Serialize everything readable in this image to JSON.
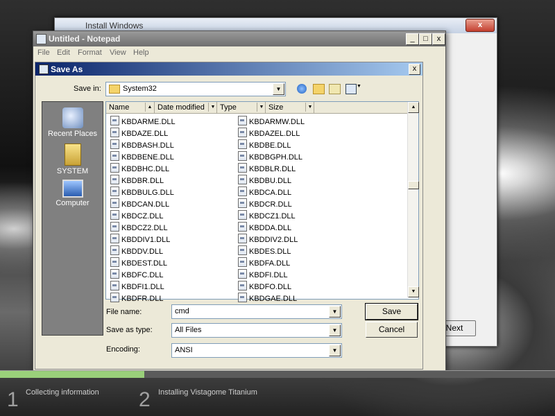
{
  "colors": {
    "titlebar_active": "#0a246a",
    "progress": "#9ad07a",
    "window_bg": "#ece9d8"
  },
  "install_window": {
    "title": "Install Windows",
    "close_label": "x",
    "next_button": "Next"
  },
  "notepad": {
    "title": "Untitled - Notepad",
    "min": "_",
    "max": "□",
    "close": "x",
    "menu": [
      "File",
      "Edit",
      "Format",
      "View",
      "Help"
    ]
  },
  "saveas": {
    "title": "Save As",
    "close": "x",
    "save_in_label": "Save in:",
    "save_in_value": "System32",
    "toolbar_icons": [
      "back-icon",
      "up-folder-icon",
      "new-folder-icon",
      "view-menu-icon"
    ],
    "places": [
      "Recent Places",
      "SYSTEM",
      "Computer"
    ],
    "columns": [
      "Name",
      "Date modified",
      "Type",
      "Size"
    ],
    "files_left": [
      "KBDARME.DLL",
      "KBDAZE.DLL",
      "KBDBASH.DLL",
      "KBDBENE.DLL",
      "KBDBHC.DLL",
      "KBDBR.DLL",
      "KBDBULG.DLL",
      "KBDCAN.DLL",
      "KBDCZ.DLL",
      "KBDCZ2.DLL",
      "KBDDIV1.DLL",
      "KBDDV.DLL",
      "KBDEST.DLL",
      "KBDFC.DLL",
      "KBDFI1.DLL",
      "KBDFR.DLL"
    ],
    "files_right": [
      "KBDARMW.DLL",
      "KBDAZEL.DLL",
      "KBDBE.DLL",
      "KBDBGPH.DLL",
      "KBDBLR.DLL",
      "KBDBU.DLL",
      "KBDCA.DLL",
      "KBDCR.DLL",
      "KBDCZ1.DLL",
      "KBDDA.DLL",
      "KBDDIV2.DLL",
      "KBDES.DLL",
      "KBDFA.DLL",
      "KBDFI.DLL",
      "KBDFO.DLL",
      "KBDGAE.DLL"
    ],
    "file_name_label": "File name:",
    "file_name_value": "cmd",
    "save_type_label": "Save as type:",
    "save_type_value": "All Files",
    "encoding_label": "Encoding:",
    "encoding_value": "ANSI",
    "save_button": "Save",
    "cancel_button": "Cancel"
  },
  "progress": {
    "fraction": 0.26,
    "steps": [
      {
        "num": "1",
        "label": "Collecting information"
      },
      {
        "num": "2",
        "label": "Installing Vistagome Titanium"
      }
    ]
  }
}
